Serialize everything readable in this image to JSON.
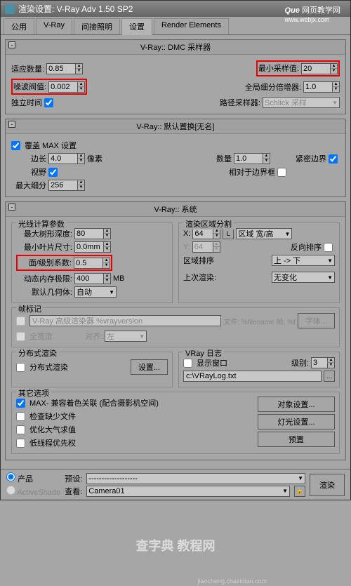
{
  "titlebar": "渲染设置: V-Ray Adv 1.50 SP2",
  "watermark_top": {
    "logo": "Que",
    "text": "网页教学网",
    "url": "www.webjx.com"
  },
  "tabs": [
    "公用",
    "V-Ray",
    "间接照明",
    "设置",
    "Render Elements"
  ],
  "dmc": {
    "header": "V-Ray:: DMC 采样器",
    "adapt_amount_lbl": "适应数量:",
    "adapt_amount": "0.85",
    "min_samples_lbl": "最小采样值:",
    "min_samples": "20",
    "noise_lbl": "噪波阀值:",
    "noise": "0.002",
    "global_subdiv_lbl": "全局细分倍增器:",
    "global_subdiv": "1.0",
    "indep_time_lbl": "独立时间",
    "path_sampler_lbl": "路径采样器:",
    "path_sampler": "Schlick 采样"
  },
  "default_disp": {
    "header": "V-Ray:: 默认置换[无名]",
    "override_lbl": "覆盖 MAX 设置",
    "edge_lbl": "边长",
    "edge": "4.0",
    "pixels": "像素",
    "amount_lbl": "数量",
    "amount": "1.0",
    "tight_lbl": "紧密边界",
    "view_lbl": "视野",
    "relative_lbl": "相对于边界框",
    "max_subdiv_lbl": "最大细分",
    "max_subdiv": "256"
  },
  "system": {
    "header": "V-Ray:: 系统",
    "ray_group": "光线计算参数",
    "max_depth_lbl": "最大树形深度:",
    "max_depth": "80",
    "min_leaf_lbl": "最小叶片尺寸:",
    "min_leaf": "0.0mm",
    "face_level_lbl": "面/级别系数:",
    "face_level": "0.5",
    "dyn_mem_lbl": "动态内存极限:",
    "dyn_mem": "400",
    "mb": "MB",
    "def_geom_lbl": "默认几何体:",
    "def_geom": "自动",
    "region_group": "渲染区域分割",
    "x_lbl": "X:",
    "x_val": "64",
    "L": "L",
    "y_lbl": "Y:",
    "y_val": "64",
    "region_wh_lbl": "区域 宽/高",
    "reverse_lbl": "反向排序",
    "region_seq_lbl": "区域排序",
    "region_seq": "上 -> 下",
    "prev_lbl": "上次渲染:",
    "prev": "无变化",
    "frame_group": "帧标记",
    "frame_text": "V-Ray 高级渲染器 %vrayversion",
    "file_lbl": "文件: %filename",
    "frame_lbl2": "帧: %f",
    "font_btn": "字体...",
    "full_width_lbl": "全宽度",
    "align_lbl": "对齐:",
    "align": "左",
    "dist_group": "分布式渲染",
    "dist_check": "分布式渲染",
    "settings_btn": "设置...",
    "log_group": "VRay 日志",
    "show_window_lbl": "显示窗口",
    "level_lbl": "级别:",
    "level": "3",
    "log_path": "c:\\VRayLog.txt",
    "other_group": "其它选项",
    "max_compat_lbl": "MAX- 兼容着色关联 (配合摄影机空间)",
    "check_missing_lbl": "检查缺少文件",
    "optimize_lbl": "优化大气求值",
    "low_thread_lbl": "低线程优先权",
    "obj_settings": "对象设置...",
    "light_settings": "灯光设置...",
    "presets": "预置"
  },
  "bottom": {
    "product": "产品",
    "activeshade": "ActiveShade",
    "preset_lbl": "预设:",
    "preset_val": "-------------------",
    "view_lbl": "查看:",
    "view_val": "Camera01",
    "render_btn": "渲染"
  },
  "wm_bottom": "查字典 教程网",
  "wm_url": "jiaocheng.chazidian.com"
}
